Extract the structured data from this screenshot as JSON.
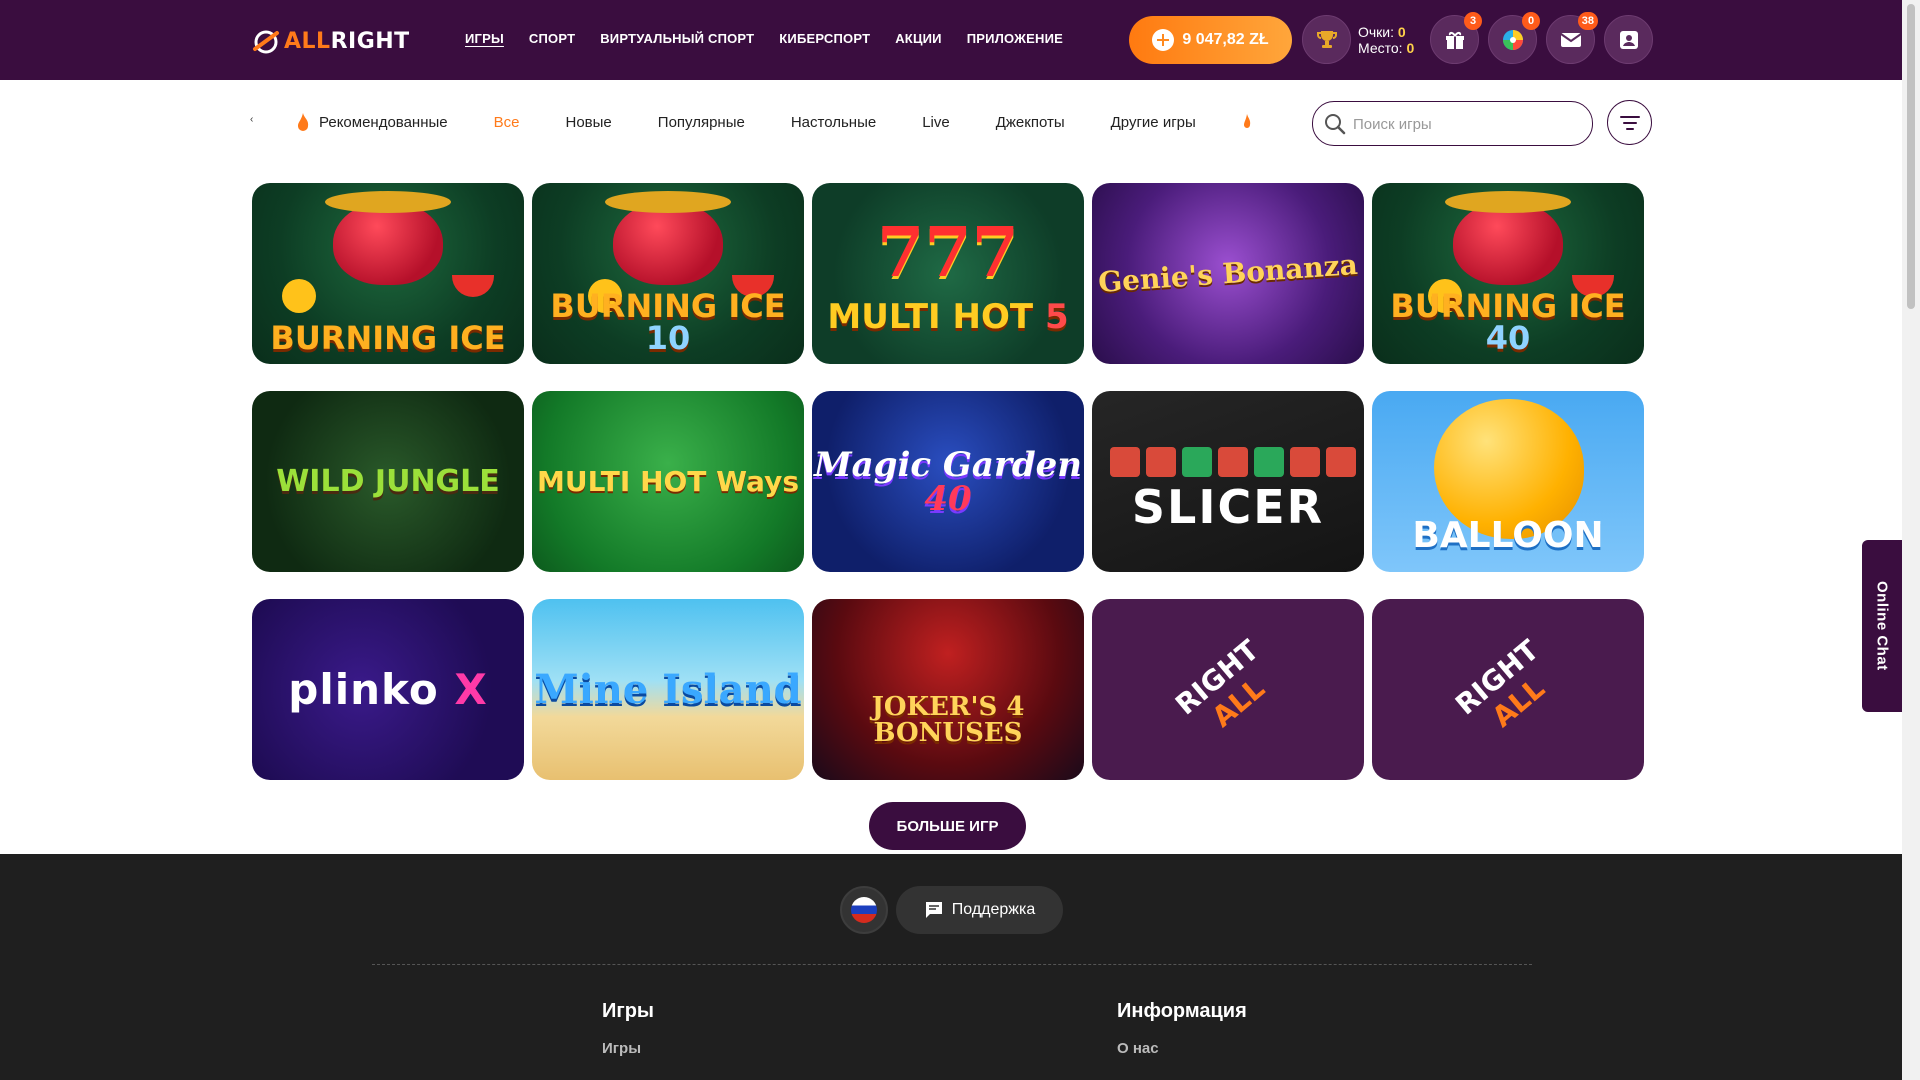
{
  "header": {
    "logo_all": "ALL",
    "logo_right": "RIGHT",
    "nav": [
      "ИГРЫ",
      "СПОРТ",
      "ВИРТУАЛЬНЫЙ СПОРТ",
      "КИБЕРСПОРТ",
      "АКЦИИ",
      "ПРИЛОЖЕНИЕ"
    ],
    "balance": "9 047,82 ZŁ",
    "points_label": "Очки:",
    "points_value": "0",
    "place_label": "Место:",
    "place_value": "0",
    "badges": {
      "gifts": "3",
      "wheel": "0",
      "messages": "38"
    }
  },
  "categories": {
    "items": [
      "Рекомендованные",
      "Все",
      "Новые",
      "Популярные",
      "Настольные",
      "Live",
      "Джекпоты",
      "Другие игры"
    ],
    "active": "Все"
  },
  "search": {
    "placeholder": "Поиск игры"
  },
  "games": [
    {
      "title": "BURNING ICE",
      "style": "burn",
      "suffix": ""
    },
    {
      "title": "BURNING ICE",
      "style": "burn",
      "suffix": "10"
    },
    {
      "title": "MULTI HOT",
      "style": "multihot",
      "suffix": "5"
    },
    {
      "title": "Genie's Bonanza",
      "style": "genie",
      "suffix": ""
    },
    {
      "title": "BURNING ICE",
      "style": "burn",
      "suffix": "40"
    },
    {
      "title": "WILD JUNGLE",
      "style": "jungle",
      "suffix": ""
    },
    {
      "title": "MULTI HOT Ways",
      "style": "ways",
      "suffix": ""
    },
    {
      "title": "Magic Garden",
      "style": "magic",
      "suffix": "40"
    },
    {
      "title": "SLICER",
      "style": "slicer",
      "suffix": ""
    },
    {
      "title": "BALLOON",
      "style": "balloon",
      "suffix": ""
    },
    {
      "title": "plinko",
      "style": "plinko",
      "suffix": "X"
    },
    {
      "title": "Mine Island",
      "style": "mine",
      "suffix": ""
    },
    {
      "title": "JOKER'S 4 BONUSES",
      "style": "joker",
      "suffix": ""
    },
    {
      "title": "",
      "style": "logo",
      "suffix": ""
    },
    {
      "title": "",
      "style": "logo",
      "suffix": ""
    }
  ],
  "tile_logo": {
    "all": "ALL",
    "right": "RIGHT"
  },
  "more_button": "БОЛЬШЕ ИГР",
  "footer": {
    "support": "Поддержка",
    "col1_title": "Игры",
    "col1_link": "Игры",
    "col2_title": "Информация",
    "col2_link": "О нас"
  },
  "online_chat": "Online Chat",
  "colors": {
    "brand": "#3a0d3f",
    "accent": "#ff7a1a",
    "badge": "#ff5b1a"
  }
}
